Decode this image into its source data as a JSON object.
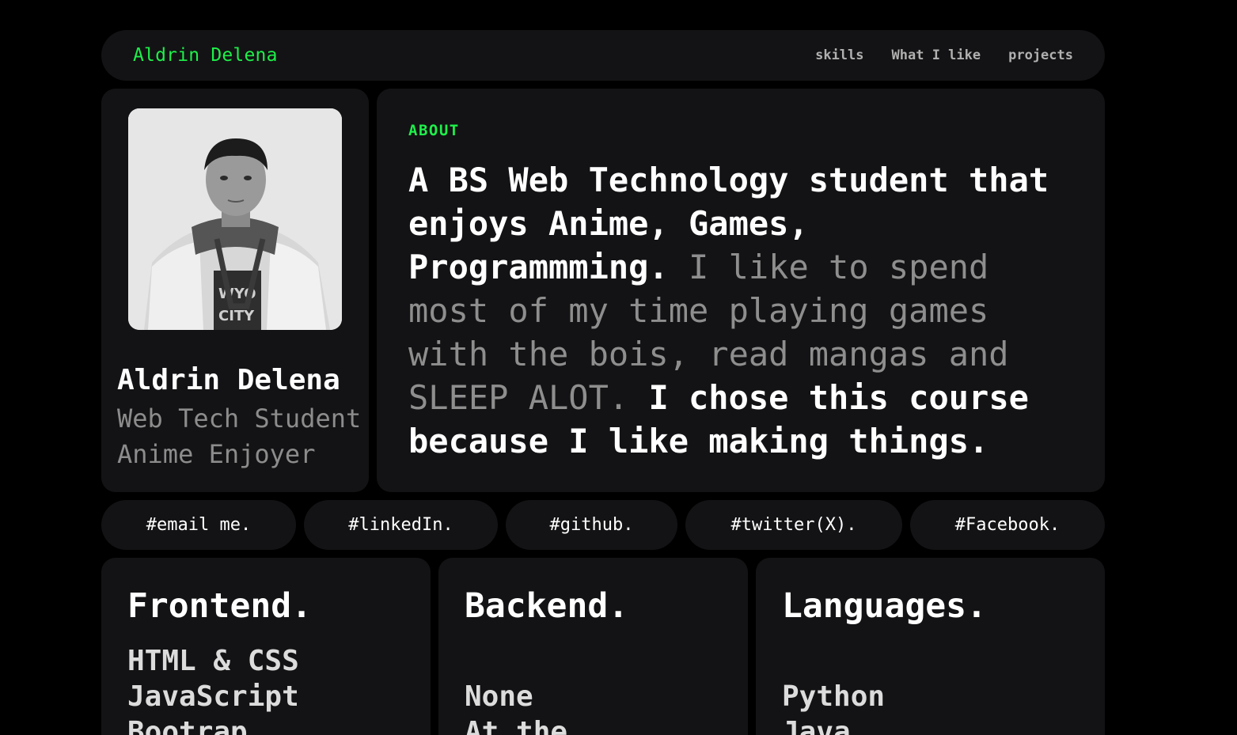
{
  "nav": {
    "brand": "Aldrin Delena",
    "links": [
      "skills",
      "What I like",
      "projects"
    ]
  },
  "profile": {
    "name": "Aldrin Delena",
    "roles": [
      "Web Tech Student",
      "Anime Enjoyer"
    ],
    "photo_icon": "person-photo"
  },
  "about": {
    "label": "ABOUT",
    "intro": "A BS Web Technology student that enjoys Anime, Games, Programmming.",
    "middle": "I like to spend most of my time playing games with the bois, read mangas and SLEEP ALOT.",
    "closing": "I chose this course because I like making things."
  },
  "socials": [
    "#email me.",
    "#linkedIn.",
    "#github.",
    "#twitter(X).",
    "#Facebook."
  ],
  "skills": [
    {
      "title": "Frontend.",
      "items": [
        "HTML & CSS",
        "JavaScript",
        "Bootrap"
      ]
    },
    {
      "title": "Backend.",
      "items": [
        "None",
        "At the"
      ]
    },
    {
      "title": "Languages.",
      "items": [
        "Python",
        "Java"
      ]
    }
  ],
  "colors": {
    "accent": "#1ef04a",
    "background": "#000000",
    "card": "#131315",
    "muted_text": "#8e8e8e"
  }
}
